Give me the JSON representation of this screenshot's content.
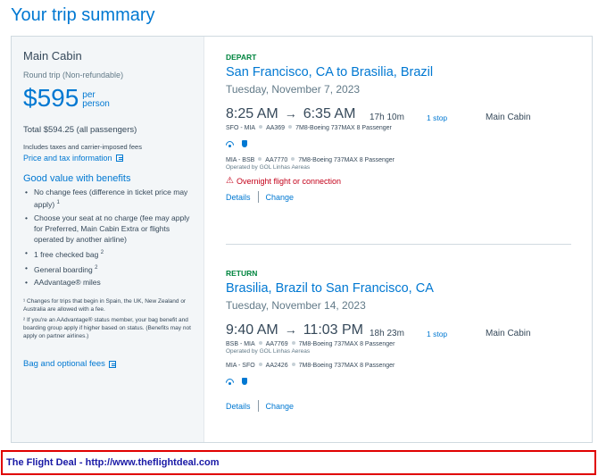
{
  "page_title": "Your trip summary",
  "summary": {
    "cabin": "Main Cabin",
    "trip_type": "Round trip (Non-refundable)",
    "price": "$595",
    "per": "per",
    "person": "person",
    "total": "Total $594.25 (all passengers)",
    "taxes_note": "Includes taxes and carrier-imposed fees",
    "price_tax_link": "Price and tax information",
    "benefits_heading": "Good value with benefits",
    "benefits": [
      {
        "text": "No change fees (difference in ticket price may apply)",
        "sup": "1"
      },
      {
        "text": "Choose your seat at no charge (fee may apply for Preferred, Main Cabin Extra or flights operated by another airline)",
        "sup": ""
      },
      {
        "text": "1 free checked bag",
        "sup": "2"
      },
      {
        "text": "General boarding",
        "sup": "2"
      },
      {
        "text": "AAdvantage® miles",
        "sup": ""
      }
    ],
    "footnote_1": "¹ Changes for trips that begin in Spain, the UK, New Zealand or Australia are allowed with a fee.",
    "footnote_2": "² If you're an AAdvantage® status member, your bag benefit and boarding group apply if higher based on status. (Benefits may not apply on partner airlines.)",
    "bag_link": "Bag and optional fees"
  },
  "depart": {
    "label": "DEPART",
    "route": "San Francisco, CA to Brasilia, Brazil",
    "date": "Tuesday, November 7, 2023",
    "dep_time": "8:25 AM",
    "arrow": "→",
    "arr_time": "6:35 AM",
    "duration": "17h 10m",
    "stops": "1 stop",
    "cabin": "Main Cabin",
    "leg1": {
      "route": "SFO - MIA",
      "flight": "AA369",
      "aircraft": "7M8-Boeing 737MAX 8 Passenger"
    },
    "leg2": {
      "route": "MIA - BSB",
      "flight": "AA7770",
      "aircraft": "7M8-Boeing 737MAX 8 Passenger"
    },
    "operated_by": "Operated by GOL Linhas Aereas",
    "warning": "Overnight flight or connection",
    "details": "Details",
    "change": "Change"
  },
  "return": {
    "label": "RETURN",
    "route": "Brasilia, Brazil to San Francisco, CA",
    "date": "Tuesday, November 14, 2023",
    "dep_time": "9:40 AM",
    "arrow": "→",
    "arr_time": "11:03 PM",
    "duration": "18h 23m",
    "stops": "1 stop",
    "cabin": "Main Cabin",
    "leg1": {
      "route": "BSB - MIA",
      "flight": "AA7769",
      "aircraft": "7M8-Boeing 737MAX 8 Passenger"
    },
    "operated_by": "Operated by GOL Linhas Aereas",
    "leg2": {
      "route": "MIA - SFO",
      "flight": "AA2426",
      "aircraft": "7M8-Boeing 737MAX 8 Passenger"
    },
    "details": "Details",
    "change": "Change"
  },
  "footer": "The Flight Deal - http://www.theflightdeal.com",
  "colors": {
    "link": "#0078d2",
    "depart_label": "#00853f",
    "warning": "#c30019",
    "footer_border": "#e00000"
  }
}
